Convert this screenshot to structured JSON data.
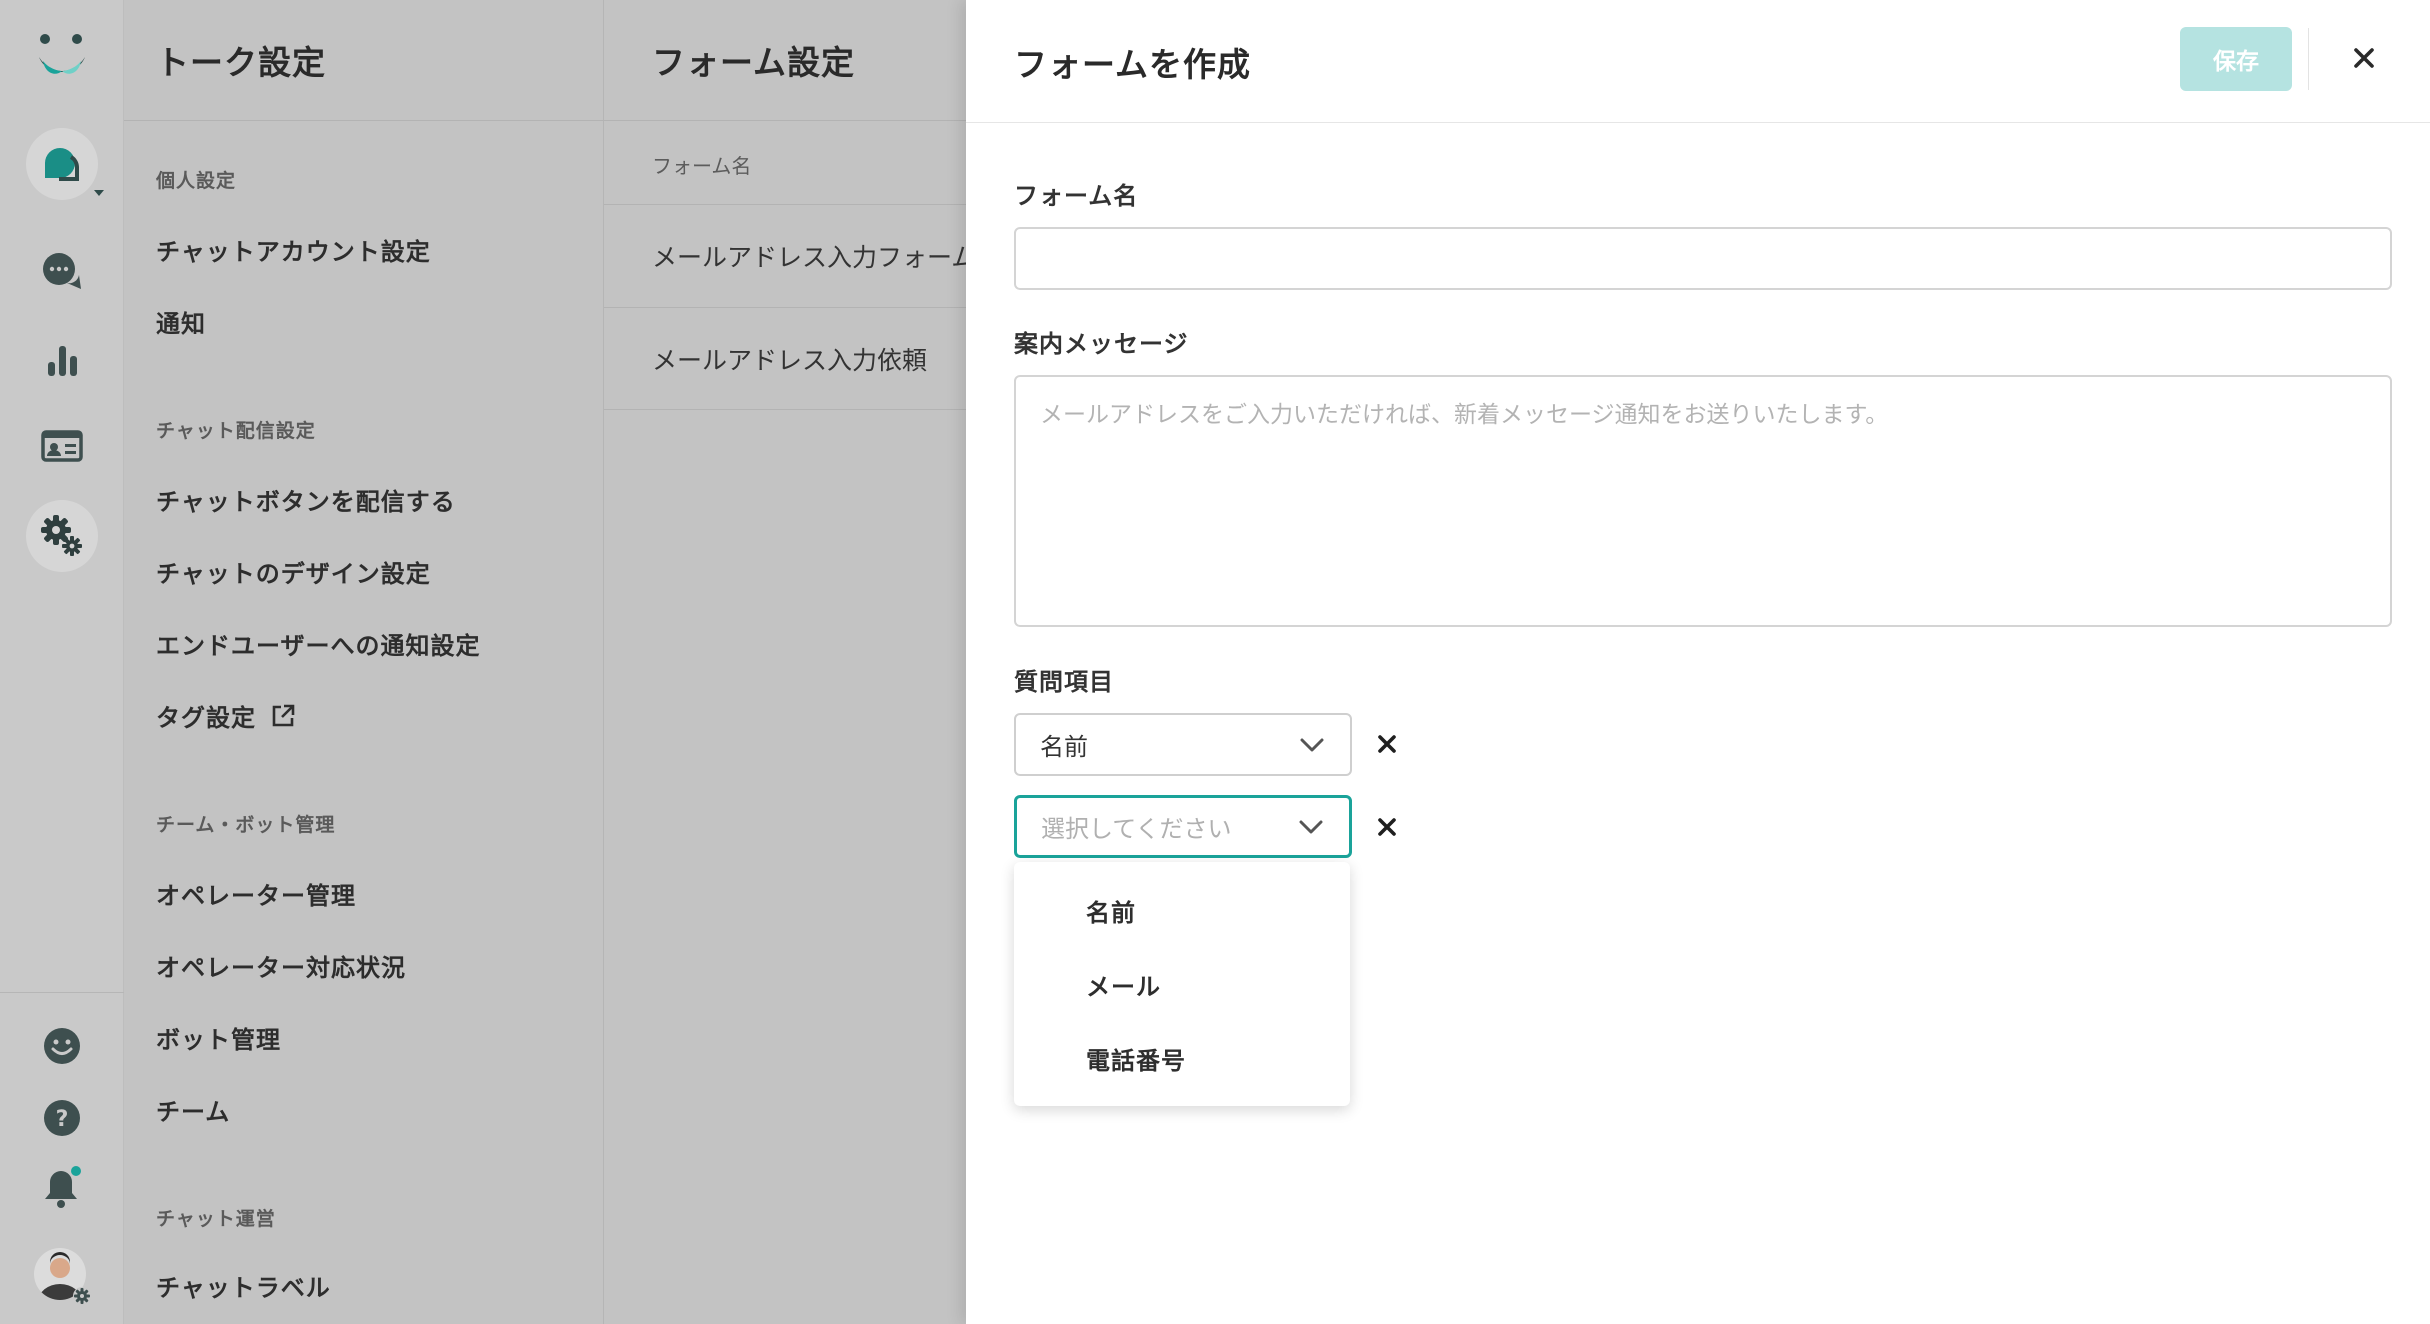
{
  "sidebar": {
    "title": "トーク設定",
    "sections": [
      {
        "label": "個人設定",
        "items": [
          "チャットアカウント設定",
          "通知"
        ]
      },
      {
        "label": "チャット配信設定",
        "items": [
          "チャットボタンを配信する",
          "チャットのデザイン設定",
          "エンドユーザーへの通知設定",
          "タグ設定"
        ]
      },
      {
        "label": "チーム・ボット管理",
        "items": [
          "オペレーター管理",
          "オペレーター対応状況",
          "ボット管理",
          "チーム"
        ]
      },
      {
        "label": "チャット運営",
        "items": [
          "チャットラベル"
        ]
      }
    ]
  },
  "forms_pane": {
    "title": "フォーム設定",
    "column_header": "フォーム名",
    "rows": [
      "メールアドレス入力フォーム",
      "メールアドレス入力依頼"
    ]
  },
  "panel": {
    "title": "フォームを作成",
    "save_label": "保存",
    "form_name_label": "フォーム名",
    "form_name_value": "",
    "message_label": "案内メッセージ",
    "message_placeholder": "メールアドレスをご入力いただければ、新着メッセージ通知をお送りいたします。",
    "questions_label": "質問項目",
    "question_selects": [
      {
        "value": "名前"
      },
      {
        "placeholder": "選択してください"
      }
    ],
    "dropdown_options": [
      "名前",
      "メール",
      "電話番号"
    ]
  },
  "colors": {
    "accent": "#1aa39a",
    "save_disabled": "#b5e3e1",
    "notification_dot": "#1aa39a"
  }
}
